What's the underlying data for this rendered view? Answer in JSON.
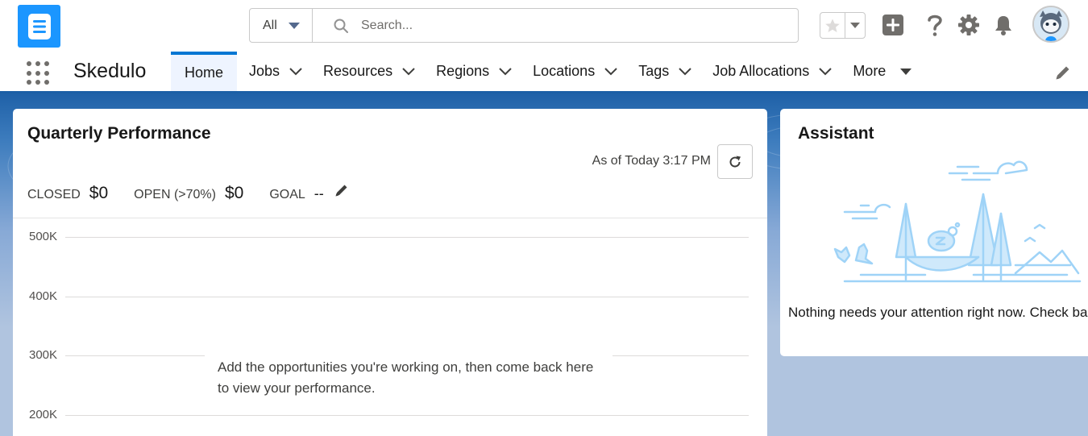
{
  "header": {
    "search": {
      "scope": "All",
      "placeholder": "Search..."
    }
  },
  "nav": {
    "app_name": "Skedulo",
    "items": [
      {
        "label": "Home",
        "active": true
      },
      {
        "label": "Jobs"
      },
      {
        "label": "Resources"
      },
      {
        "label": "Regions"
      },
      {
        "label": "Locations"
      },
      {
        "label": "Tags"
      },
      {
        "label": "Job Allocations"
      },
      {
        "label": "More"
      }
    ]
  },
  "performance": {
    "title": "Quarterly Performance",
    "as_of": "As of Today 3:17 PM",
    "closed_label": "CLOSED",
    "closed_value": "$0",
    "open_label": "OPEN (>70%)",
    "open_value": "$0",
    "goal_label": "GOAL",
    "goal_value": "--",
    "y_ticks": [
      "500K",
      "400K",
      "300K",
      "200K"
    ],
    "empty_message": "Add the opportunities you're working on, then come back here to view your performance."
  },
  "assistant": {
    "title": "Assistant",
    "message": "Nothing needs your attention right now. Check back later."
  },
  "colors": {
    "brand_blue": "#1b96ff",
    "active_tab_border": "#0176d3",
    "nav_underline": "#1b5fa6",
    "illustration": "#9fd3f7"
  }
}
